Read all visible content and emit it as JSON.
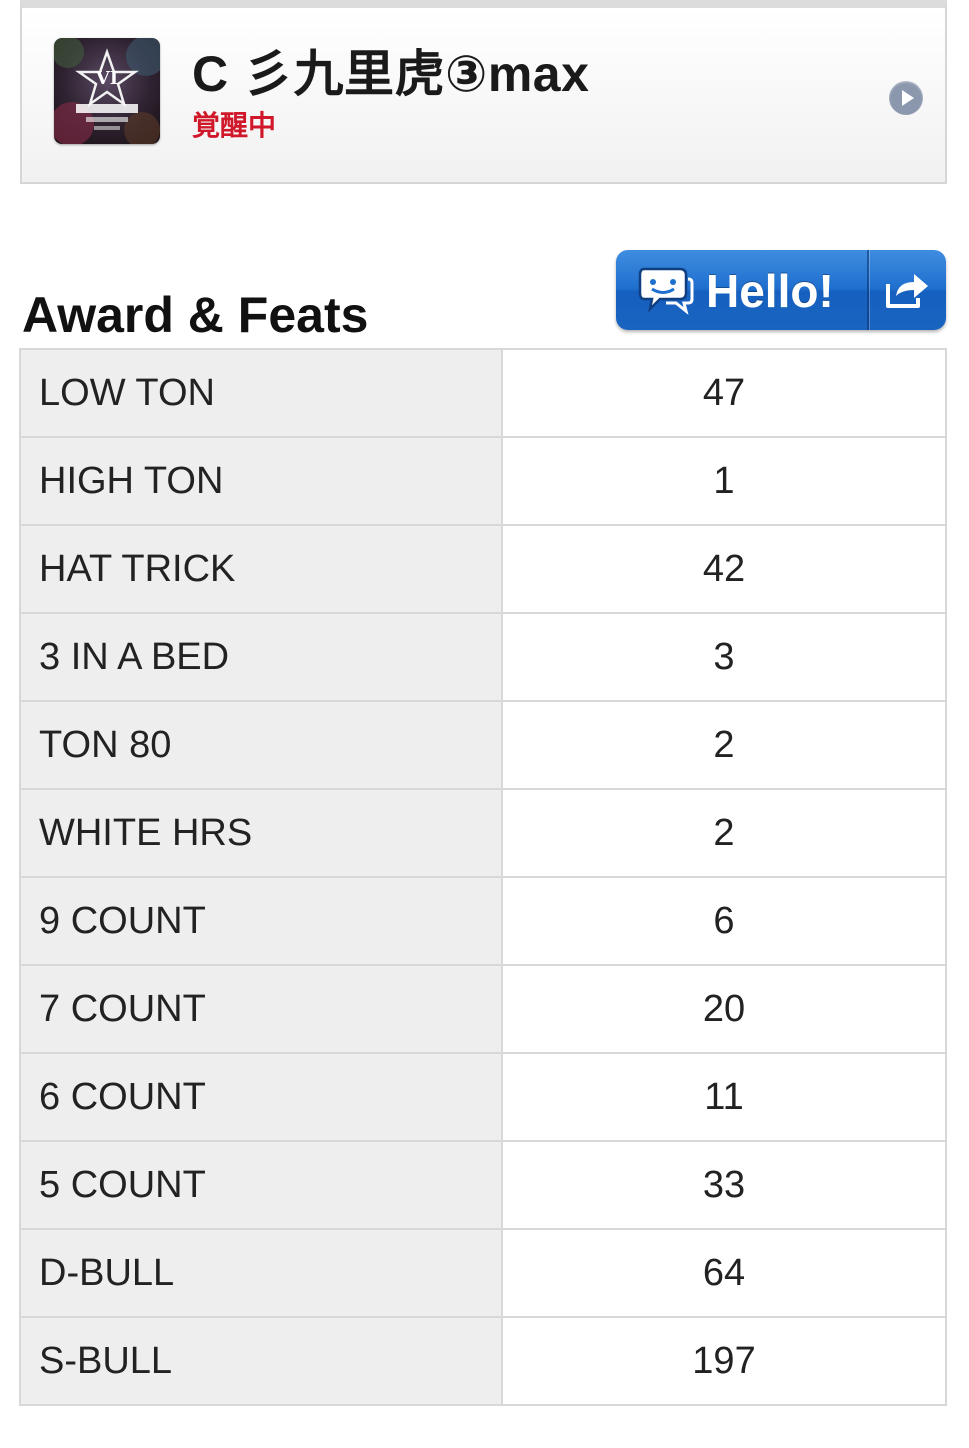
{
  "profile": {
    "name": "C 彡九里虎③max",
    "status": "覚醒中",
    "avatar_icon": "event-badge-icon",
    "status_color": "#d0182a"
  },
  "awards_section": {
    "title": "Award & Feats",
    "hello_button": {
      "label": "Hello!",
      "icon": "chat-bubble-icon",
      "share_icon": "share-icon",
      "color": "#1f6fcf"
    },
    "rows": [
      {
        "label": "LOW TON",
        "value": "47"
      },
      {
        "label": "HIGH TON",
        "value": "1"
      },
      {
        "label": "HAT TRICK",
        "value": "42"
      },
      {
        "label": "3 IN A BED",
        "value": "3"
      },
      {
        "label": "TON 80",
        "value": "2"
      },
      {
        "label": "WHITE HRS",
        "value": "2"
      },
      {
        "label": "9 COUNT",
        "value": "6"
      },
      {
        "label": "7 COUNT",
        "value": "20"
      },
      {
        "label": "6 COUNT",
        "value": "11"
      },
      {
        "label": "5 COUNT",
        "value": "33"
      },
      {
        "label": "D-BULL",
        "value": "64"
      },
      {
        "label": "S-BULL",
        "value": "197"
      }
    ]
  }
}
